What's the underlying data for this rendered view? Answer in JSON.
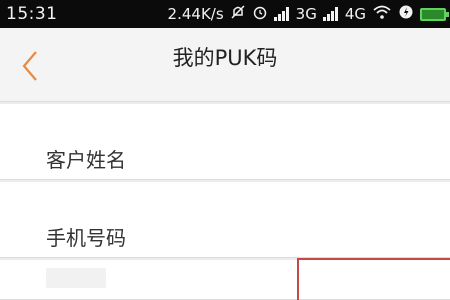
{
  "status_bar": {
    "time": "15:31",
    "net_speed": "2.44K/s",
    "network_3g": "3G",
    "network_4g": "4G",
    "icons": [
      "mute-icon",
      "alarm-icon",
      "signal-icon",
      "signal-icon",
      "wifi-icon",
      "data-saver-icon",
      "battery-icon"
    ]
  },
  "header": {
    "back_icon": "chevron-left-icon",
    "title": "我的PUK码"
  },
  "form": {
    "fields": [
      {
        "label": "客户姓名"
      },
      {
        "label": "手机号码"
      }
    ]
  },
  "colors": {
    "accent": "#e8893f",
    "status_bar_bg": "#0b0b0b",
    "battery": "#5fd35f",
    "code_box_border": "#c44a4a"
  }
}
